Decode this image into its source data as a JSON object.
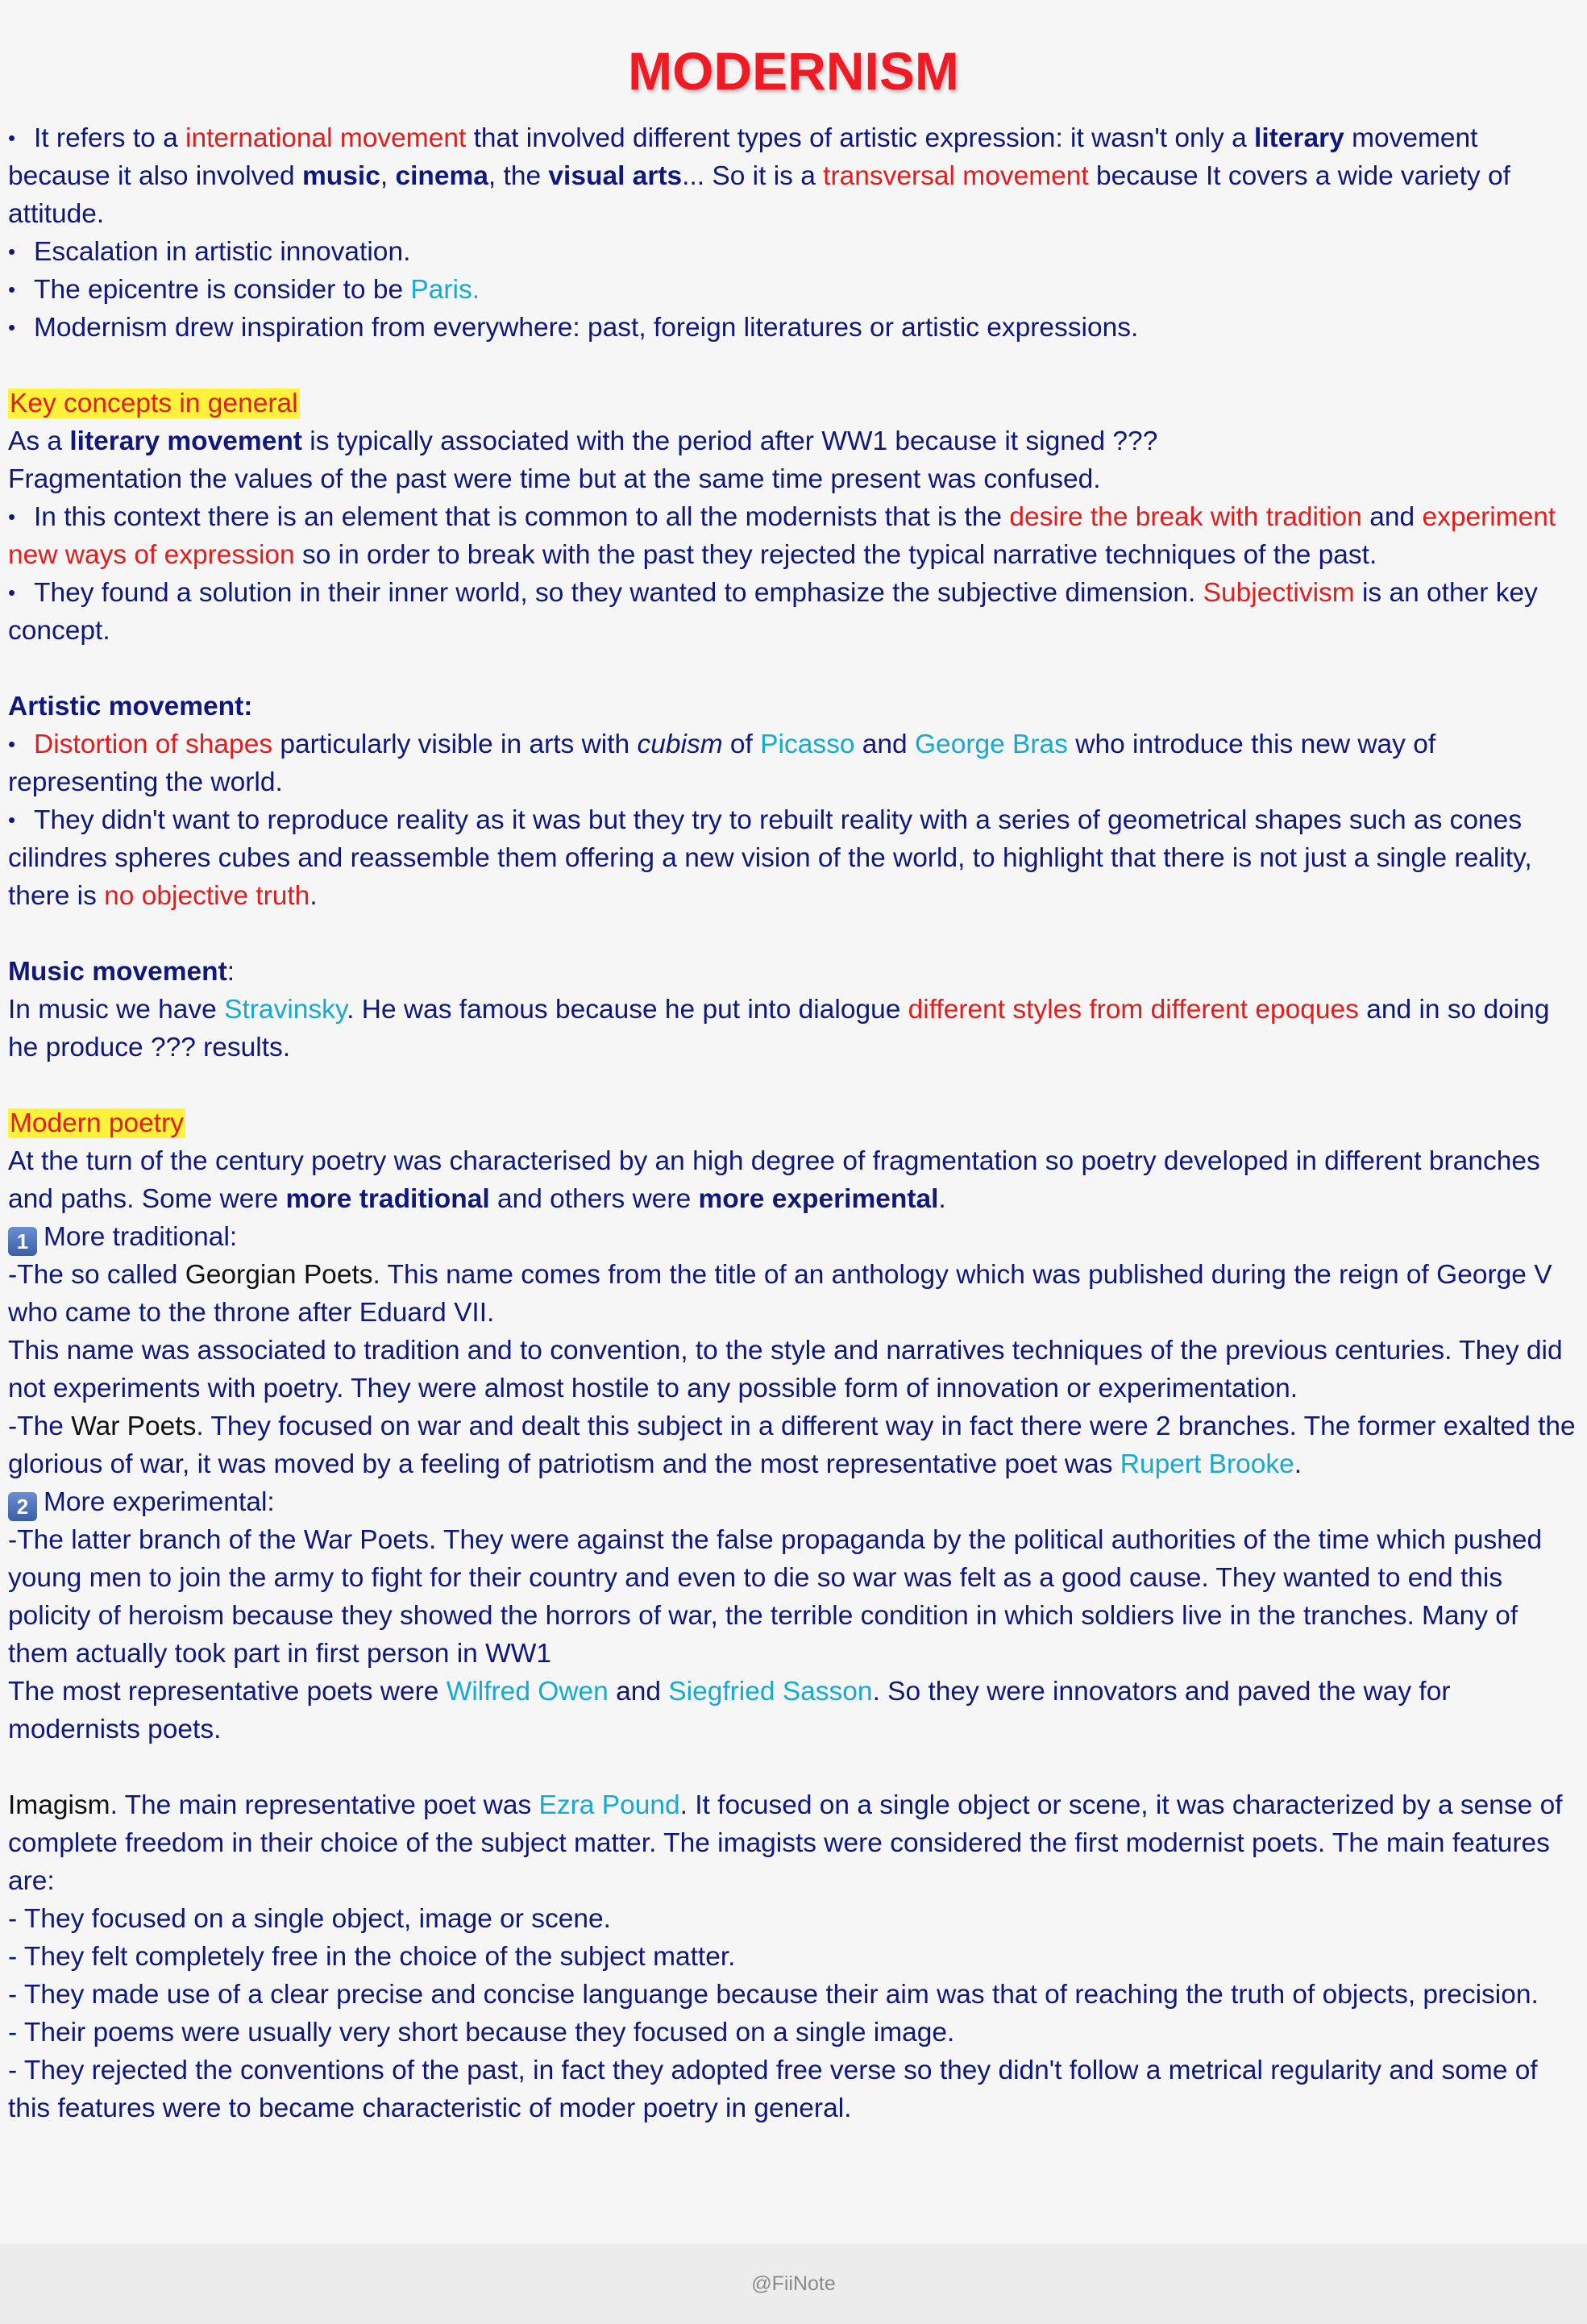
{
  "title": "MODERNISM",
  "intro": {
    "b1": {
      "t1": "It refers to a ",
      "t2": "international movement",
      "t3": " that involved different types of artistic expression: it wasn't only a ",
      "t4": "literary",
      "t5": " movement because it also involved ",
      "t6": "music",
      "t7": ", ",
      "t8": "cinema",
      "t9": ", the ",
      "t10": "visual arts",
      "t11": "... So it is a ",
      "t12": "transversal movement",
      "t13": " because It covers a wide variety of attitude."
    },
    "b2": "Escalation in artistic innovation.",
    "b3": {
      "t1": "The epicentre is consider to be ",
      "t2": "Paris."
    },
    "b4": "Modernism drew inspiration from everywhere: past, foreign literatures or artistic expressions."
  },
  "key": {
    "heading": "Key concepts in general",
    "l1": {
      "t1": "As a ",
      "t2": "literary movement",
      "t3": " is typically associated with the period after WW1 because it signed ???"
    },
    "l2": "Fragmentation the values of the past were time but at the same time present was confused.",
    "b1": {
      "t1": "In this context there is an element that is common to all the modernists that is the ",
      "t2": "desire the break with tradition",
      "t3": " and ",
      "t4": "experiment new ways of expression",
      "t5": " so in order to break with the past they rejected the typical narrative techniques of the past."
    },
    "b2": {
      "t1": "They found a solution in their inner world, so they wanted to emphasize the subjective dimension. ",
      "t2": "Subjectivism",
      "t3": " is an other key concept."
    }
  },
  "artistic": {
    "heading": "Artistic movement:",
    "b1": {
      "t1": "Distortion of shapes",
      "t2": " particularly visible in arts with ",
      "t3": "cubism",
      "t4": " of ",
      "t5": "Picasso",
      "t6": " and ",
      "t7": "George Bras",
      "t8": " who introduce this new way of representing the world."
    },
    "b2": {
      "t1": "They didn't want to reproduce reality as it was but they try to rebuilt reality with a series of geometrical shapes such as cones cilindres spheres cubes and reassemble them offering a new vision of the world, to highlight that there is not just a single reality, there is ",
      "t2": "no objective truth",
      "t3": "."
    }
  },
  "music": {
    "heading": "Music movement",
    "colon": ":",
    "l1": {
      "t1": "In music we have ",
      "t2": "Stravinsky",
      "t3": ". He was famous because he put into dialogue ",
      "t4": "different styles from different epoques",
      "t5": " and in so doing he produce ???  results."
    }
  },
  "poetry": {
    "heading": "Modern poetry",
    "l1": {
      "t1": "At the turn of the century poetry was characterised by an high degree of fragmentation so poetry developed in different branches and paths.  Some were ",
      "t2": "more traditional",
      "t3": " and others were ",
      "t4": "more experimental",
      "t5": "."
    },
    "n1": {
      "num": "1",
      "label": "More traditional:"
    },
    "l2": {
      "t1": "-The so called ",
      "t2": "Georgian Poets",
      "t3": ". This name comes from the title of an anthology which was published during the reign of George V who came to the throne after Eduard VII."
    },
    "l3": "This name was associated to tradition and to convention, to the style and narratives techniques of the previous centuries. They did not experiments with poetry. They were almost hostile to any possible form of innovation or experimentation.",
    "l4": {
      "t1": "-The ",
      "t2": "War Poets",
      "t3": ". They focused on war and dealt this subject in a different way in fact there were 2 branches. The former exalted the glorious of war, it was moved by a feeling of patriotism and the most representative poet was ",
      "t4": "Rupert Brooke",
      "t5": "."
    },
    "n2": {
      "num": "2",
      "label": "More experimental:"
    },
    "l5": " -The latter branch of the War Poets. They were against the false propaganda by the political authorities of the time which pushed young men to join the army to fight for their country and even to die so war was felt as a good cause. They wanted to end this policity of heroism because they showed the horrors of war,  the terrible condition in which soldiers live in the tranches. Many of them actually took part in first person in WW1",
    "l6": {
      "t1": "The most representative poets were ",
      "t2": "Wilfred Owen",
      "t3": " and ",
      "t4": "Siegfried Sasson",
      "t5": ". So they were innovators and paved the way for modernists poets."
    }
  },
  "imagism": {
    "l1": {
      "t1": "Imagism",
      "t2": ". The main representative poet was ",
      "t3": "Ezra Pound",
      "t4": ". It focused on a single object or scene, it was characterized by a sense of complete freedom in their choice of the subject matter. The imagists were considered the first modernist poets. The main features are:"
    },
    "items": [
      "- They focused on a single object, image or scene.",
      "- They felt completely free in the choice of the subject matter.",
      "- They made use of a clear precise and concise languange because their aim was that of reaching the truth of objects, precision.",
      "- Their poems were usually very short because they focused on a single image.",
      "- They rejected the conventions of the past, in fact they adopted free verse so they didn't follow a metrical regularity and some of this features were to became characteristic of moder poetry in general."
    ]
  },
  "footer": "@FiiNote"
}
